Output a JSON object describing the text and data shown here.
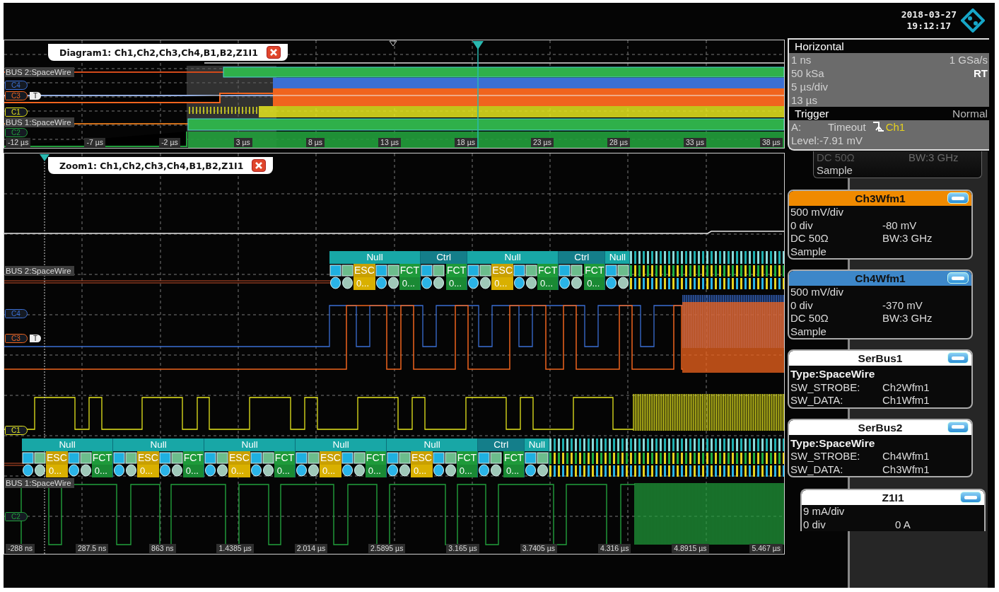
{
  "overview": {
    "title": "Diagram1: Ch1,Ch2,Ch3,Ch4,B1,B2,Z1I1",
    "tracks": [
      {
        "kind": "bus",
        "label": "BUS 2:SpaceWire"
      },
      {
        "kind": "channel",
        "label": "C4",
        "color": "#3b6fd4"
      },
      {
        "kind": "channel",
        "label": "C3",
        "color": "#f0641e",
        "trigger_marker": "T"
      },
      {
        "kind": "channel",
        "label": "C1",
        "color": "#e6e61e"
      },
      {
        "kind": "bus",
        "label": "BUS 1:SpaceWire"
      },
      {
        "kind": "channel",
        "label": "C2",
        "color": "#22a03c"
      }
    ],
    "xticks": [
      "-12 µs",
      "-7 µs",
      "-2 µs",
      "3 µs",
      "8 µs",
      "13 µs",
      "18 µs",
      "23 µs",
      "28 µs",
      "33 µs",
      "38 µs"
    ]
  },
  "zoom": {
    "title": "Zoom1: Ch1,Ch2,Ch3,Ch4,B1,B2,Z1I1",
    "tracks": [
      {
        "kind": "bus",
        "label": "BUS 2:SpaceWire",
        "frames": [
          {
            "label": "Null",
            "symbols": [
              {
                "kind": "esc",
                "label": "ESC",
                "value": "0..."
              },
              {
                "kind": "fct",
                "label": "FCT",
                "value": "0..."
              }
            ]
          },
          {
            "label": "Ctrl",
            "symbols": [
              {
                "kind": "fct",
                "label": "FCT",
                "value": "0..."
              }
            ]
          },
          {
            "label": "Null",
            "symbols": [
              {
                "kind": "esc",
                "label": "ESC",
                "value": "0..."
              },
              {
                "kind": "fct",
                "label": "FCT",
                "value": "0..."
              }
            ]
          },
          {
            "label": "Ctrl",
            "symbols": [
              {
                "kind": "fct",
                "label": "FCT",
                "value": "0..."
              }
            ]
          },
          {
            "label": "Null"
          }
        ]
      },
      {
        "kind": "channel",
        "label": "C4",
        "color": "#3b6fd4"
      },
      {
        "kind": "channel",
        "label": "C3",
        "color": "#f0641e",
        "trigger_marker": "T"
      },
      {
        "kind": "channel",
        "label": "C1",
        "color": "#e6e61e"
      },
      {
        "kind": "bus",
        "label": "BUS 1:SpaceWire",
        "frames": [
          {
            "label": "Null",
            "symbols": [
              {
                "kind": "esc",
                "label": "ESC",
                "value": "0..."
              },
              {
                "kind": "fct",
                "label": "FCT",
                "value": "0..."
              }
            ]
          },
          {
            "label": "Null",
            "symbols": [
              {
                "kind": "esc",
                "label": "ESC",
                "value": "0..."
              },
              {
                "kind": "fct",
                "label": "FCT",
                "value": "0..."
              }
            ]
          },
          {
            "label": "Null",
            "symbols": [
              {
                "kind": "esc",
                "label": "ESC",
                "value": "0..."
              },
              {
                "kind": "fct",
                "label": "FCT",
                "value": "0..."
              }
            ]
          },
          {
            "label": "Null",
            "symbols": [
              {
                "kind": "esc",
                "label": "ESC",
                "value": "0..."
              },
              {
                "kind": "fct",
                "label": "FCT",
                "value": "0..."
              }
            ]
          },
          {
            "label": "Null",
            "symbols": [
              {
                "kind": "esc",
                "label": "ESC",
                "value": "0..."
              },
              {
                "kind": "fct",
                "label": "FCT",
                "value": "0..."
              }
            ]
          },
          {
            "label": "Ctrl",
            "symbols": [
              {
                "kind": "fct",
                "label": "FCT",
                "value": "0..."
              }
            ]
          },
          {
            "label": "Null"
          }
        ]
      },
      {
        "kind": "channel",
        "label": "C2",
        "color": "#22a03c"
      }
    ],
    "xticks": [
      "-288 ns",
      "287.5 ns",
      "863 ns",
      "1.4385 µs",
      "2.014 µs",
      "2.5895 µs",
      "3.165 µs",
      "3.7405 µs",
      "4.316 µs",
      "4.8915 µs",
      "5.467 µs"
    ]
  },
  "datetime": {
    "date": "2018-03-27",
    "time": "19:12:17"
  },
  "horizontal": {
    "title": "Horizontal",
    "rows": [
      {
        "left": "1 ns",
        "right": "1 GSa/s",
        "right_bold": false
      },
      {
        "left": "50 kSa",
        "right": "RT",
        "right_bold": true
      },
      {
        "left": "5 µs/div"
      },
      {
        "left": "13 µs"
      }
    ]
  },
  "trigger": {
    "title": "Trigger",
    "mode": "Normal",
    "slot": "A:",
    "type": "Timeout",
    "source": "Ch1",
    "level_text": "Level:-7.91 mV"
  },
  "partial_card": {
    "rows": [
      {
        "left": "DC 50Ω",
        "right": "BW:3 GHz"
      },
      {
        "left": "Sample"
      }
    ]
  },
  "cards": [
    {
      "title": "Ch3Wfm1",
      "color": "#f08a00",
      "rows": [
        {
          "kind": "plain",
          "left": "500 mV/div"
        },
        {
          "kind": "plain",
          "left": "0 div",
          "right": "-80 mV"
        },
        {
          "kind": "plain",
          "left": "DC 50Ω",
          "right": "BW:3 GHz"
        },
        {
          "kind": "plain",
          "left": "Sample"
        }
      ]
    },
    {
      "title": "Ch4Wfm1",
      "color": "#3d87c9",
      "rows": [
        {
          "kind": "plain",
          "left": "500 mV/div"
        },
        {
          "kind": "plain",
          "left": "0 div",
          "right": "-370 mV"
        },
        {
          "kind": "plain",
          "left": "DC 50Ω",
          "right": "BW:3 GHz"
        },
        {
          "kind": "plain",
          "left": "Sample"
        }
      ]
    },
    {
      "title": "SerBus1",
      "color": "#ffffff",
      "rows": [
        {
          "kind": "bold",
          "left": "Type:SpaceWire"
        },
        {
          "kind": "plain",
          "left": "SW_STROBE:",
          "right": "Ch2Wfm1"
        },
        {
          "kind": "plain",
          "left": "SW_DATA:",
          "right": "Ch1Wfm1"
        }
      ]
    },
    {
      "title": "SerBus2",
      "color": "#ffffff",
      "rows": [
        {
          "kind": "bold",
          "left": "Type:SpaceWire"
        },
        {
          "kind": "plain",
          "left": "SW_STROBE:",
          "right": "Ch4Wfm1"
        },
        {
          "kind": "plain",
          "left": "SW_DATA:",
          "right": "Ch3Wfm1"
        }
      ]
    },
    {
      "title": "Z1I1",
      "color": "#ffffff",
      "rows": [
        {
          "kind": "plain",
          "left": "9 mA/div"
        },
        {
          "kind": "plain",
          "left": "0 div",
          "right": "0 A"
        }
      ]
    }
  ]
}
